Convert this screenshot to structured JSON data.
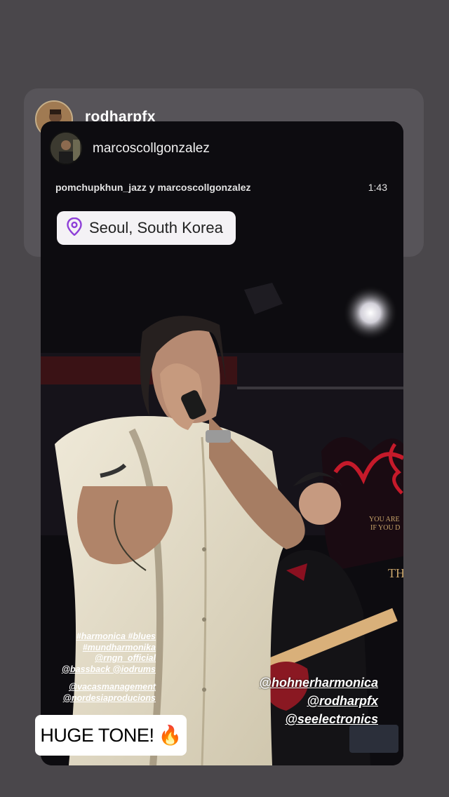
{
  "story": {
    "reposter_username": "rodharpfx",
    "original_username": "marcoscollgonzalez",
    "collab_line": "pomchupkhun_jazz y marcoscollgonzalez",
    "time": "1:43",
    "location": "Seoul, South Korea",
    "tags_left": [
      "#harmonica #blues",
      "#mundharmonika",
      "@rngn_official",
      "@bassback @iodrums",
      "@vacasmanagement",
      "@nordesiaproducions"
    ],
    "tags_right": [
      "@hohnerharmonica",
      "@rodharpfx",
      "@seelectronics"
    ],
    "sticker_text": "HUGE TONE!",
    "sticker_emoji": "🔥",
    "poster_text": [
      "YOU ARE",
      "IF YOU D",
      "TH"
    ]
  },
  "colors": {
    "page_bg": "#4a474b",
    "card_bg": "#575459",
    "location_pin": "#8e3fd8",
    "poster_red": "#c51a2a"
  },
  "icons": {
    "location": "location-pin-icon",
    "fire": "fire-emoji"
  }
}
